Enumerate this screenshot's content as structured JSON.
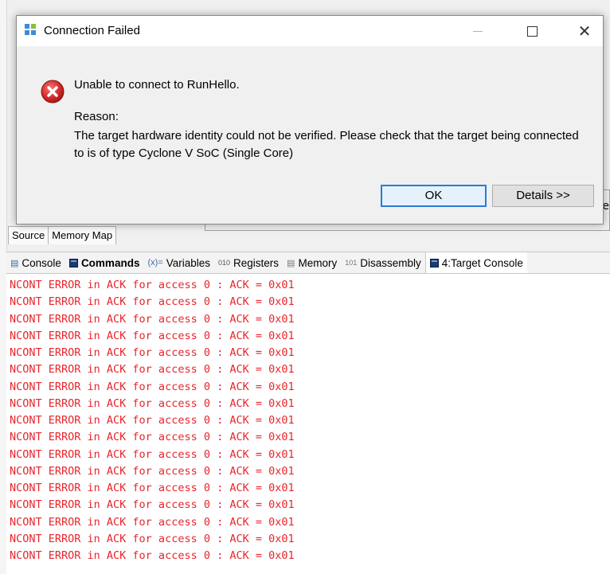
{
  "dialog": {
    "title": "Connection Failed",
    "message": "Unable to connect to RunHello.",
    "reason_label": "Reason:",
    "reason_text": "The target hardware identity could not be verified. Please check that the target being connected to is of type Cyclone V SoC (Single Core)",
    "ok_label": "OK",
    "details_label": "Details >>",
    "window_controls": {
      "minimize": "minimize",
      "maximize": "maximize",
      "close": "close"
    }
  },
  "behind_window": {
    "edge_text": "e"
  },
  "editor_tabs": [
    "Source",
    "Memory Map"
  ],
  "view_tabs": [
    {
      "label": "Console",
      "icon": "console-icon"
    },
    {
      "label": "Commands",
      "icon": "commands-icon"
    },
    {
      "label": "Variables",
      "icon": "variables-icon"
    },
    {
      "label": "Registers",
      "icon": "registers-icon"
    },
    {
      "label": "Memory",
      "icon": "memory-icon"
    },
    {
      "label": "Disassembly",
      "icon": "disassembly-icon"
    },
    {
      "label": "4:Target Console",
      "icon": "target-console-icon"
    }
  ],
  "console": {
    "text_color": "#e8252b",
    "lines": [
      "NCONT ERROR in ACK for access 0 : ACK = 0x01",
      "NCONT ERROR in ACK for access 0 : ACK = 0x01",
      "NCONT ERROR in ACK for access 0 : ACK = 0x01",
      "NCONT ERROR in ACK for access 0 : ACK = 0x01",
      "NCONT ERROR in ACK for access 0 : ACK = 0x01",
      "NCONT ERROR in ACK for access 0 : ACK = 0x01",
      "NCONT ERROR in ACK for access 0 : ACK = 0x01",
      "NCONT ERROR in ACK for access 0 : ACK = 0x01",
      "NCONT ERROR in ACK for access 0 : ACK = 0x01",
      "NCONT ERROR in ACK for access 0 : ACK = 0x01",
      "NCONT ERROR in ACK for access 0 : ACK = 0x01",
      "NCONT ERROR in ACK for access 0 : ACK = 0x01",
      "NCONT ERROR in ACK for access 0 : ACK = 0x01",
      "NCONT ERROR in ACK for access 0 : ACK = 0x01",
      "NCONT ERROR in ACK for access 0 : ACK = 0x01",
      "NCONT ERROR in ACK for access 0 : ACK = 0x01",
      "NCONT ERROR in ACK for access 0 : ACK = 0x01"
    ]
  }
}
